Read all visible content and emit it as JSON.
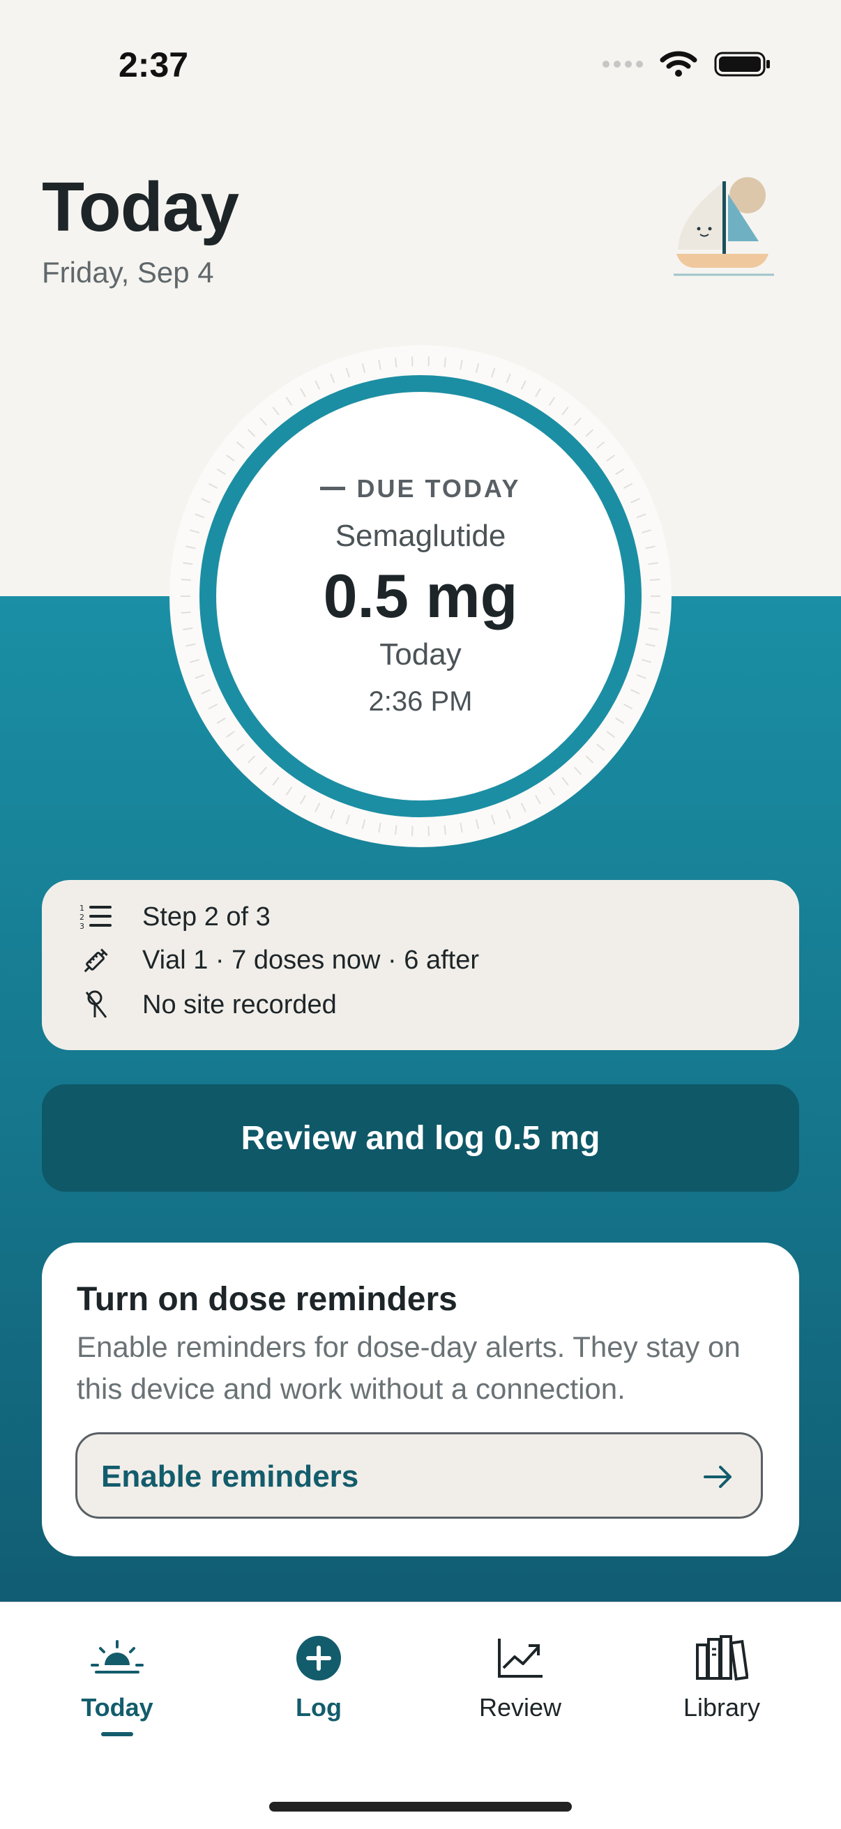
{
  "status_bar": {
    "time": "2:37"
  },
  "header": {
    "title": "Today",
    "date": "Friday, Sep 4"
  },
  "dose_dial": {
    "status": "DUE TODAY",
    "medication": "Semaglutide",
    "dose": "0.5 mg",
    "day": "Today",
    "time": "2:36 PM"
  },
  "info_card": {
    "step": "Step 2 of 3",
    "vial": "Vial 1 · 7 doses now · 6 after",
    "site": "No site recorded"
  },
  "primary_action": {
    "label": "Review and log 0.5 mg"
  },
  "reminder_card": {
    "title": "Turn on dose reminders",
    "body": "Enable reminders for dose-day alerts. They stay on this device and work without a connection.",
    "button_label": "Enable reminders"
  },
  "tab_bar": {
    "items": [
      {
        "label": "Today",
        "icon": "sunrise-icon",
        "selected": true
      },
      {
        "label": "Log",
        "icon": "plus-circle-icon",
        "selected": false
      },
      {
        "label": "Review",
        "icon": "trend-chart-icon",
        "selected": false
      },
      {
        "label": "Library",
        "icon": "books-icon",
        "selected": false
      }
    ]
  },
  "colors": {
    "teal_dark": "#0e5868",
    "teal": "#1a8fa5",
    "background": "#f6f4f0",
    "card": "#f1eee9"
  }
}
